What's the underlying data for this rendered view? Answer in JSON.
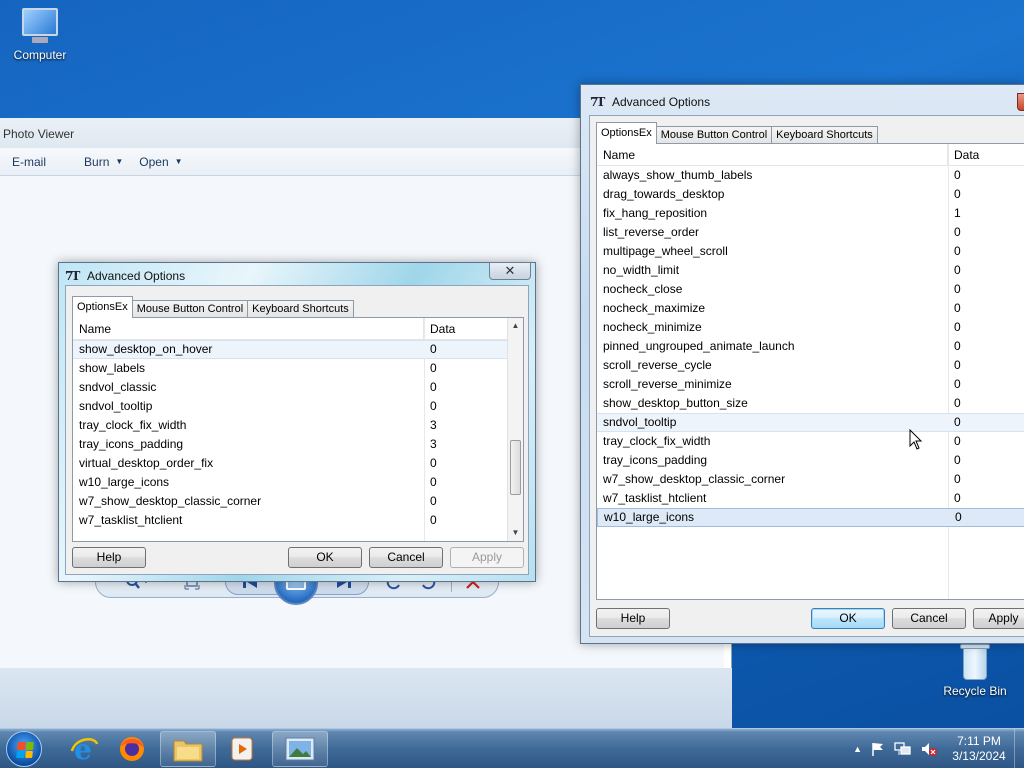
{
  "desktop": {
    "computer_label": "Computer",
    "recycle_label": "Recycle Bin"
  },
  "photo_viewer": {
    "title": "Photo Viewer",
    "menu": [
      {
        "label": "E-mail",
        "has_arrow": false
      },
      {
        "label": "Burn",
        "has_arrow": true
      },
      {
        "label": "Open",
        "has_arrow": true
      }
    ],
    "menu_arrow_glyph": "▼"
  },
  "dialog_small": {
    "title": "Advanced Options",
    "app_icon_text": "7T",
    "close_glyph": "✕",
    "tabs": [
      "OptionsEx",
      "Mouse Button Control",
      "Keyboard Shortcuts"
    ],
    "columns": [
      "Name",
      "Data"
    ],
    "rows": [
      {
        "name": "show_desktop_on_hover",
        "data": "0"
      },
      {
        "name": "show_labels",
        "data": "0"
      },
      {
        "name": "sndvol_classic",
        "data": "0"
      },
      {
        "name": "sndvol_tooltip",
        "data": "0"
      },
      {
        "name": "tray_clock_fix_width",
        "data": "3"
      },
      {
        "name": "tray_icons_padding",
        "data": "3"
      },
      {
        "name": "virtual_desktop_order_fix",
        "data": "0"
      },
      {
        "name": "w10_large_icons",
        "data": "0"
      },
      {
        "name": "w7_show_desktop_classic_corner",
        "data": "0"
      },
      {
        "name": "w7_tasklist_htclient",
        "data": "0"
      }
    ],
    "buttons": {
      "help": "Help",
      "ok": "OK",
      "cancel": "Cancel",
      "apply": "Apply"
    }
  },
  "dialog_large": {
    "title": "Advanced Options",
    "app_icon_text": "7T",
    "close_glyph": "✕",
    "tabs": [
      "OptionsEx",
      "Mouse Button Control",
      "Keyboard Shortcuts"
    ],
    "columns": [
      "Name",
      "Data"
    ],
    "rows": [
      {
        "name": "always_show_thumb_labels",
        "data": "0"
      },
      {
        "name": "drag_towards_desktop",
        "data": "0"
      },
      {
        "name": "fix_hang_reposition",
        "data": "1"
      },
      {
        "name": "list_reverse_order",
        "data": "0"
      },
      {
        "name": "multipage_wheel_scroll",
        "data": "0"
      },
      {
        "name": "no_width_limit",
        "data": "0"
      },
      {
        "name": "nocheck_close",
        "data": "0"
      },
      {
        "name": "nocheck_maximize",
        "data": "0"
      },
      {
        "name": "nocheck_minimize",
        "data": "0"
      },
      {
        "name": "pinned_ungrouped_animate_launch",
        "data": "0"
      },
      {
        "name": "scroll_reverse_cycle",
        "data": "0"
      },
      {
        "name": "scroll_reverse_minimize",
        "data": "0"
      },
      {
        "name": "show_desktop_button_size",
        "data": "0"
      },
      {
        "name": "sndvol_tooltip",
        "data": "0"
      },
      {
        "name": "tray_clock_fix_width",
        "data": "0"
      },
      {
        "name": "tray_icons_padding",
        "data": "0"
      },
      {
        "name": "w7_show_desktop_classic_corner",
        "data": "0"
      },
      {
        "name": "w7_tasklist_htclient",
        "data": "0"
      },
      {
        "name": "w10_large_icons",
        "data": "0"
      }
    ],
    "hovered_row": "sndvol_tooltip",
    "selected_row": "w10_large_icons",
    "buttons": {
      "help": "Help",
      "ok": "OK",
      "cancel": "Cancel",
      "apply": "Apply"
    }
  },
  "taskbar": {
    "clock_time": "7:11 PM",
    "clock_date": "3/13/2024",
    "tray_expand_glyph": "▲"
  },
  "colors": {
    "desktop_blue": "#1565c0",
    "close_red": "#c7452a",
    "ok_blue": "#3c7fb1"
  }
}
